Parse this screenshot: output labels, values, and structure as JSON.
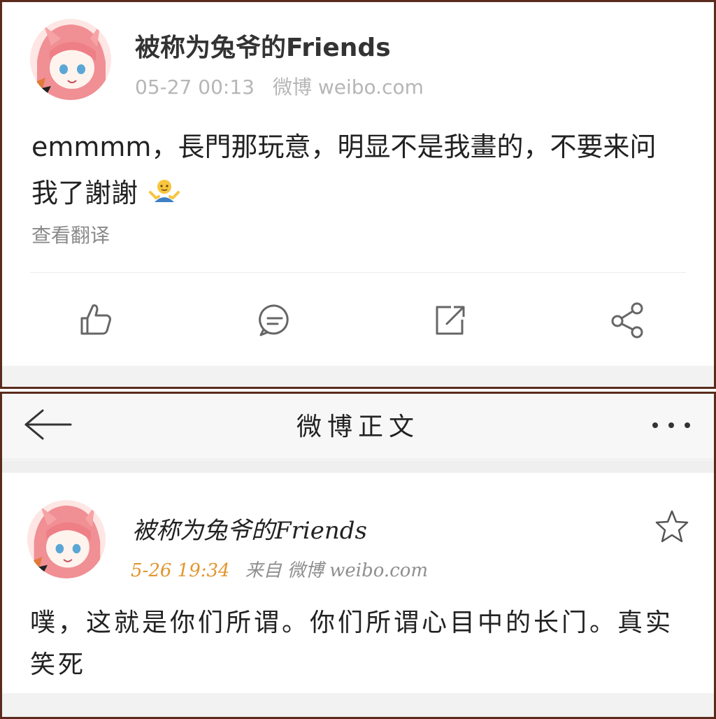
{
  "top_post": {
    "username": "被称为兔爷的Friends",
    "time": "05-27 00:13",
    "source": "微博 weibo.com",
    "text": "emmmm，長門那玩意，明显不是我畫的，不要来问我了謝謝",
    "emoji_icon": "shrug-emoji-icon",
    "translate_link": "查看翻译",
    "actions": {
      "like_icon": "thumbs-up-icon",
      "comment_icon": "comment-icon",
      "repost_icon": "repost-icon",
      "share_icon": "share-icon"
    }
  },
  "bottom_post": {
    "nav": {
      "back_icon": "back-arrow-icon",
      "title": "微博正文",
      "more_icon": "more-dots-icon"
    },
    "username": "被称为兔爷的Friends",
    "time": "5-26 19:34",
    "source": "来自 微博 weibo.com",
    "text": "噗，这就是你们所谓。你们所谓心目中的长门。真实笑死",
    "favorite_icon": "star-icon"
  },
  "colors": {
    "frame_border": "#5a2a1c",
    "meta_gray": "#b6b6b6",
    "time_orange": "#e3962f",
    "avatar_pink": "#f08f94"
  }
}
